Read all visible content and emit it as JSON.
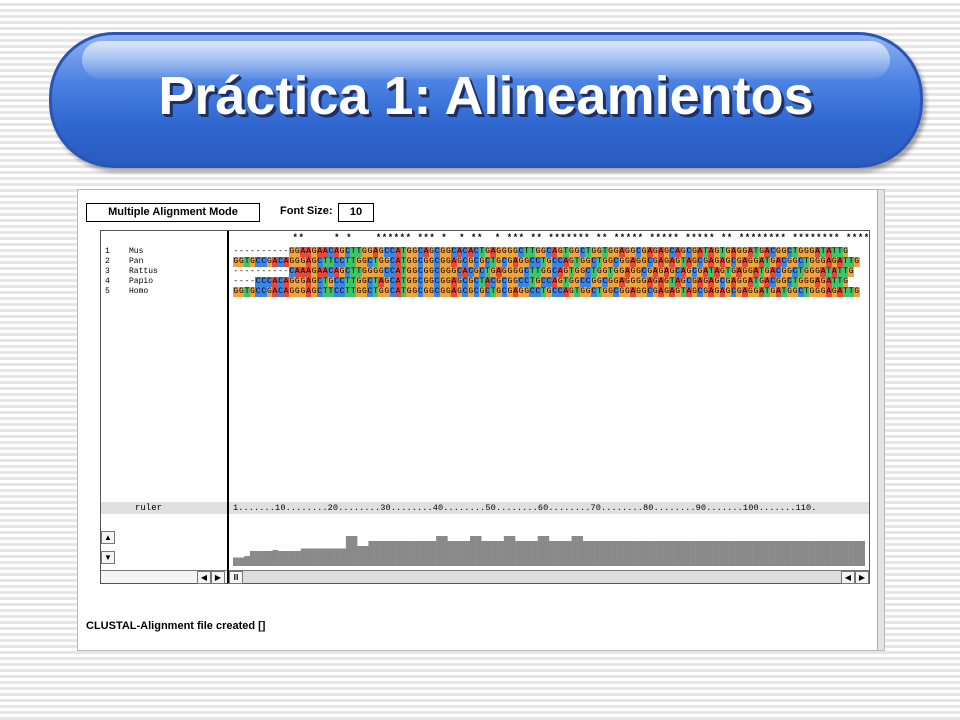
{
  "title": "Práctica 1: Alineamientos",
  "toolbar": {
    "mode_label": "Multiple Alignment Mode",
    "font_size_label": "Font Size:",
    "font_size_value": "10"
  },
  "consensus": "          **     * *    ****** *** *  * **  * *** ** ******* ** ***** ***** ***** ** ******** ******** ****",
  "sequences": [
    {
      "num": "1",
      "name": "Mus",
      "seq": "----------GGAAGAACAGCTTGGAGCCATGGCAGCGGCACACTGAGGGGCTTGGCAGTGGCTGGTGGAGGCGAGAGCAGCGATAGTGAGGATGACGGCTGGGATATTG"
    },
    {
      "num": "2",
      "name": "Pan",
      "seq": "GGTGCCGACAGGGAGCTTCCTTGGCTGGCATGGCGGCGGAGCGCGCTGCGAGGCCTGCCAGTGGCTGGCGGAGGCGAGAGTAGCGAGAGCGAGGATGACGGCTGGGAGATTG"
    },
    {
      "num": "3",
      "name": "Rattus",
      "seq": "----------CAAAGAACAGCTTGGGGCCATGGCGGCGGGCACGCTGAGGGGCTTGGCAGTGGCTGGTGGAGGCGAGAGCAGCGATAGTGAGGATGACGGCTGGGATATTG"
    },
    {
      "num": "4",
      "name": "Papio",
      "seq": "----CCCACAGGGAGCTGCCTTGGCTAGCATGGCGGCGGAGCGCTACGCGGCCTGCCAGTGGCCGGCGGAGGGGAGAGTAGCGAGAGCGAGGATGACGGCTGGGAGATTG"
    },
    {
      "num": "5",
      "name": "Homo",
      "seq": "GGTGCCGACAGGGAGCTTCCTTGGCTGGCATGGCGGCGGAGCGCGCTGCGAGGCCTGCCAGTGGCTGGCGGAGGCGAGAGTAGCGAGAGCGAGGATGATGGCTGGGAGATTG"
    }
  ],
  "ruler": {
    "label": "ruler",
    "text": "1.......10........20........30........40........50........60........70........80........90.......100.......110."
  },
  "histogram": [
    0.17,
    0.17,
    0.2,
    0.3,
    0.3,
    0.3,
    0.3,
    0.32,
    0.3,
    0.3,
    0.3,
    0.3,
    0.35,
    0.35,
    0.35,
    0.35,
    0.35,
    0.35,
    0.35,
    0.35,
    0.6,
    0.6,
    0.4,
    0.4,
    0.5,
    0.5,
    0.5,
    0.5,
    0.5,
    0.5,
    0.5,
    0.5,
    0.5,
    0.5,
    0.5,
    0.5,
    0.6,
    0.6,
    0.5,
    0.5,
    0.5,
    0.5,
    0.6,
    0.6,
    0.5,
    0.5,
    0.5,
    0.5,
    0.6,
    0.6,
    0.5,
    0.5,
    0.5,
    0.5,
    0.6,
    0.6,
    0.5,
    0.5,
    0.5,
    0.5,
    0.6,
    0.6,
    0.5,
    0.5,
    0.5,
    0.5,
    0.5,
    0.5,
    0.5,
    0.5,
    0.5,
    0.5,
    0.5,
    0.5,
    0.5,
    0.5,
    0.5,
    0.5,
    0.5,
    0.5,
    0.5,
    0.5,
    0.5,
    0.5,
    0.5,
    0.5,
    0.5,
    0.5,
    0.5,
    0.5,
    0.5,
    0.5,
    0.5,
    0.5,
    0.5,
    0.5,
    0.5,
    0.5,
    0.5,
    0.5,
    0.5,
    0.5,
    0.5,
    0.5,
    0.5,
    0.5,
    0.5,
    0.5,
    0.5,
    0.5,
    0.5,
    0.5
  ],
  "status": "CLUSTAL-Alignment file created  []",
  "colors": {
    "A": "#e8483a",
    "C": "#3a86e8",
    "G": "#f2a33a",
    "T": "#3ec46a",
    "gap": "#ffffff",
    "histogram": "#8a8a8a"
  }
}
